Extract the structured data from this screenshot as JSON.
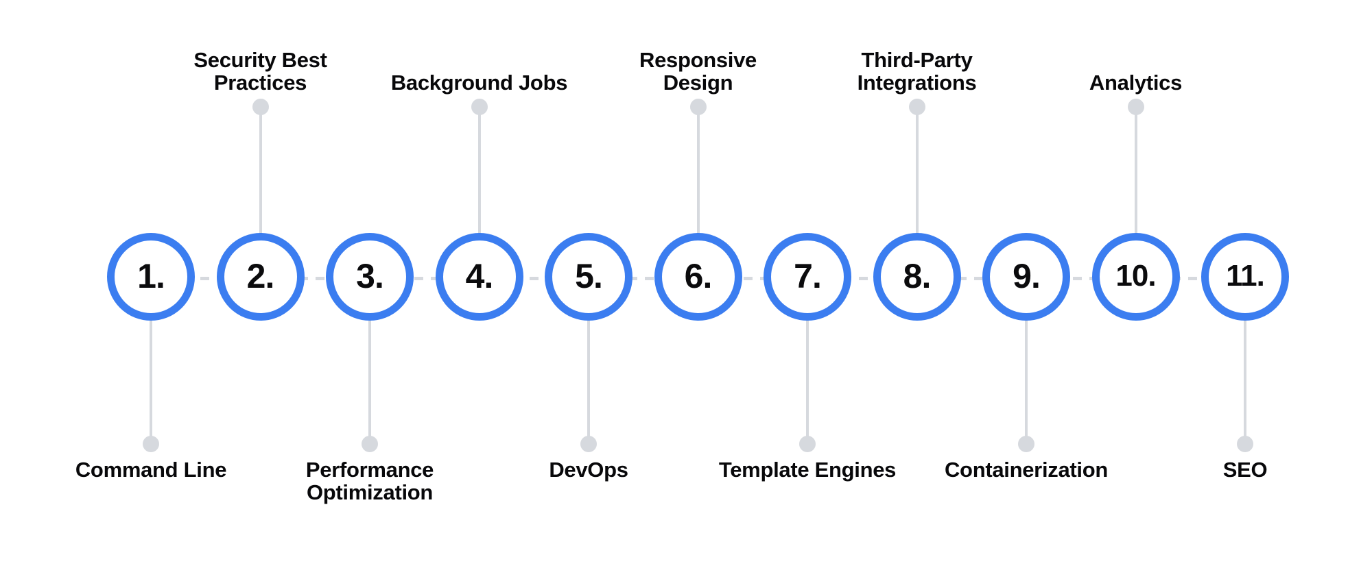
{
  "diagram": {
    "type": "horizontal-numbered-timeline",
    "orientation": "horizontal",
    "step_count": 11,
    "accent_color": "#3b7df0",
    "connector_color": "#d6d9de",
    "text_color": "#08080a",
    "background_color": "#ffffff",
    "connector_style": "dashed",
    "steps": [
      {
        "number": "1.",
        "label": "Command Line",
        "label_position": "bottom"
      },
      {
        "number": "2.",
        "label": "Security Best Practices",
        "label_position": "top"
      },
      {
        "number": "3.",
        "label": "Performance Optimization",
        "label_position": "bottom"
      },
      {
        "number": "4.",
        "label": "Background Jobs",
        "label_position": "top"
      },
      {
        "number": "5.",
        "label": "DevOps",
        "label_position": "bottom"
      },
      {
        "number": "6.",
        "label": "Responsive Design",
        "label_position": "top"
      },
      {
        "number": "7.",
        "label": "Template Engines",
        "label_position": "bottom"
      },
      {
        "number": "8.",
        "label": "Third-Party Integrations",
        "label_position": "top"
      },
      {
        "number": "9.",
        "label": "Containerization",
        "label_position": "bottom"
      },
      {
        "number": "10.",
        "label": "Analytics",
        "label_position": "top"
      },
      {
        "number": "11.",
        "label": "SEO",
        "label_position": "bottom"
      }
    ]
  }
}
